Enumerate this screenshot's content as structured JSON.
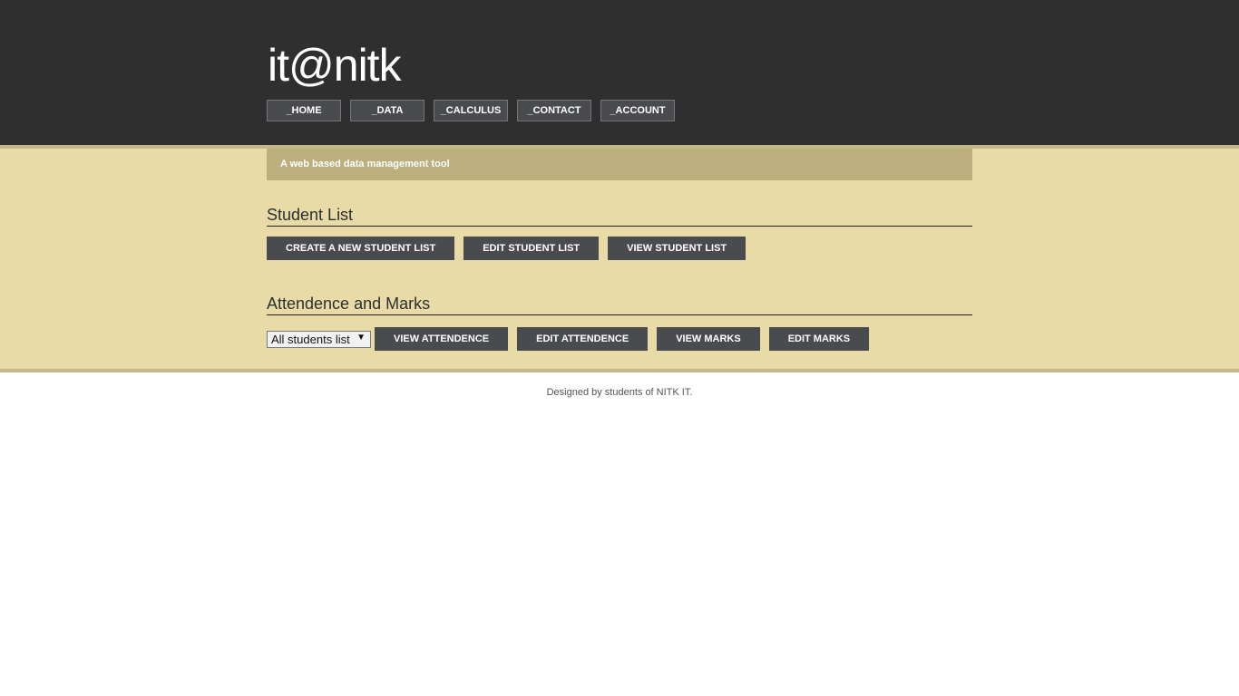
{
  "header": {
    "site_title": "it@nitk",
    "nav": [
      {
        "label": "_HOME"
      },
      {
        "label": "_DATA"
      },
      {
        "label": "_CALCULUS"
      },
      {
        "label": "_CONTACT"
      },
      {
        "label": "_ACCOUNT"
      }
    ]
  },
  "tagline": "A web based data management tool",
  "student_list": {
    "title": "Student List",
    "buttons": {
      "create": "CREATE A NEW STUDENT LIST",
      "edit": "EDIT STUDENT LIST",
      "view": "VIEW STUDENT LIST"
    }
  },
  "attendance_marks": {
    "title": "Attendence and Marks",
    "select_value": "All students list",
    "buttons": {
      "view_attendance": "VIEW ATTENDENCE",
      "edit_attendance": "EDIT ATTENDENCE",
      "view_marks": "VIEW MARKS",
      "edit_marks": "EDIT MARKS"
    }
  },
  "footer": {
    "text": "Designed by students of NITK IT."
  },
  "colors": {
    "header_bg": "#2f2f2f",
    "content_bg": "#e8dba8",
    "tagline_bg": "#bbaf7d",
    "button_bg": "#4a4b4f"
  },
  "icons": {
    "select_arrow": "triangle-down-icon"
  }
}
